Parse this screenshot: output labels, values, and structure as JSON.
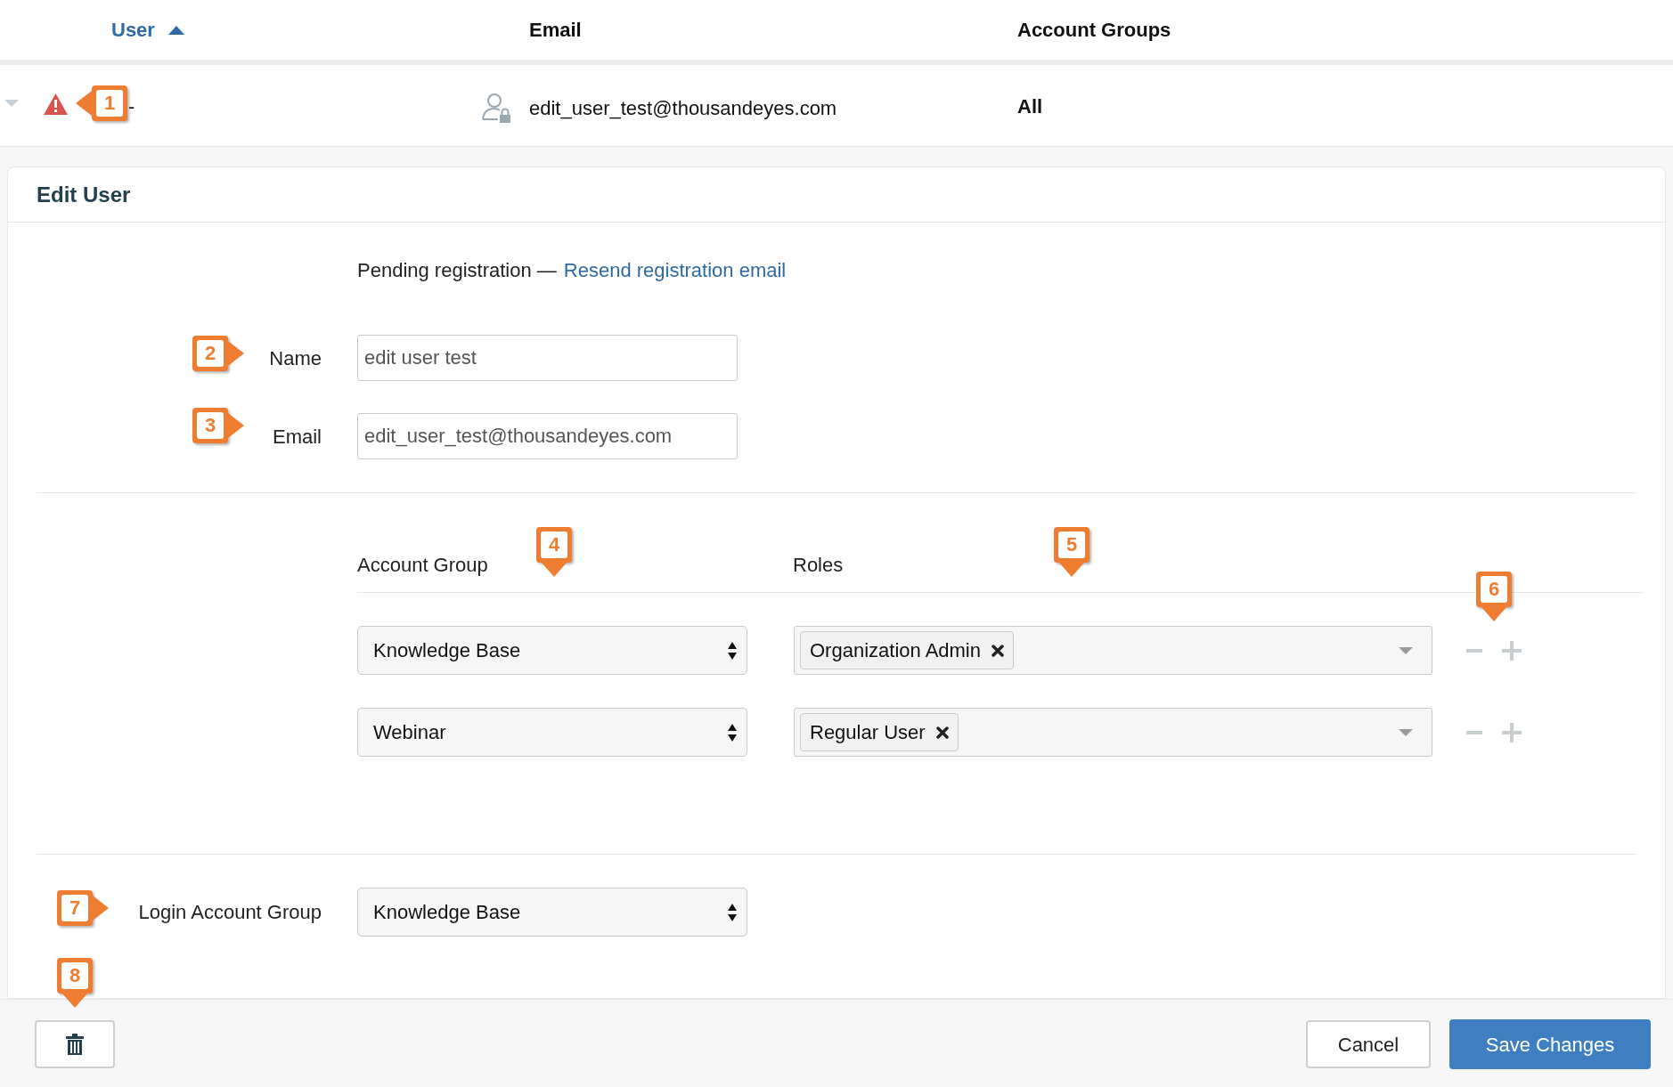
{
  "table": {
    "columns": [
      {
        "label": "User",
        "sorted": true
      },
      {
        "label": "Email",
        "sorted": false
      },
      {
        "label": "Account Groups",
        "sorted": false
      }
    ],
    "rows": [
      {
        "user": "-",
        "email": "edit_user_test@thousandeyes.com",
        "account_groups": "All",
        "callout": "1"
      }
    ]
  },
  "edit_user": {
    "title": "Edit User",
    "status": "Pending registration —",
    "link": "Resend registration email",
    "fields": [
      {
        "label": "Name",
        "value": "edit user test",
        "callout": "2"
      },
      {
        "label": "Email",
        "value": "edit_user_test@thousandeyes.com",
        "callout": "3"
      }
    ],
    "assignments": {
      "group_heading": "Account Group",
      "group_callout": "4",
      "roles_heading": "Roles",
      "roles_callout": "5",
      "actions_callout": "6",
      "rows": [
        {
          "group": "Knowledge Base",
          "roles": [
            "Organization Admin"
          ]
        },
        {
          "group": "Webinar",
          "roles": [
            "Regular User"
          ]
        }
      ]
    },
    "login": {
      "label": "Login Account Group",
      "value": "Knowledge Base",
      "callout": "7"
    },
    "delete_callout": "8",
    "cancel": "Cancel",
    "save": "Save Changes"
  }
}
